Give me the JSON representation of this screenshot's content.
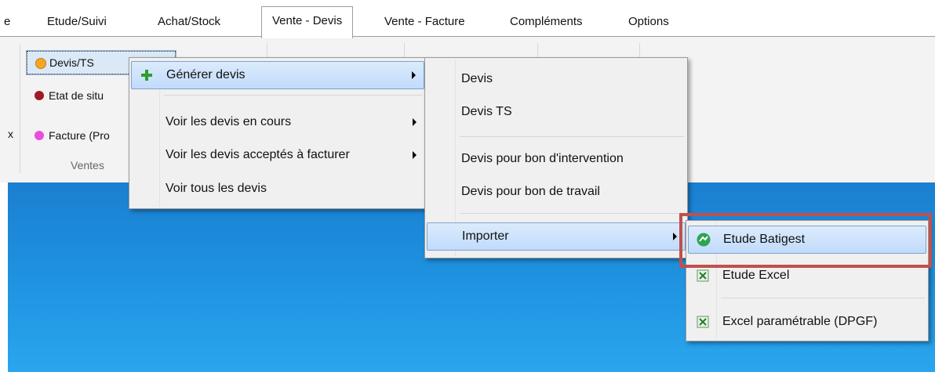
{
  "tabs": [
    {
      "label": "e"
    },
    {
      "label": "Etude/Suivi"
    },
    {
      "label": "Achat/Stock"
    },
    {
      "label": "Vente - Devis"
    },
    {
      "label": "Vente - Facture"
    },
    {
      "label": "Compléments"
    },
    {
      "label": "Options"
    }
  ],
  "ribbon": {
    "group_label": "Ventes",
    "edge_label": "x",
    "buttons": [
      {
        "label": "Devis/TS",
        "icon": "orange-dot-icon",
        "color": "#f5a623"
      },
      {
        "label": "Etat de situ",
        "icon": "red-dot-icon",
        "color": "#9e1c23"
      },
      {
        "label": "Facture (Pro",
        "icon": "pink-dot-icon",
        "color": "#e84ee0"
      }
    ]
  },
  "menu1": {
    "items": [
      {
        "label": "Générer devis",
        "icon": "plus-icon",
        "has_submenu": true
      },
      {
        "label": "Voir les devis en cours",
        "has_submenu": true
      },
      {
        "label": "Voir les devis acceptés à facturer",
        "has_submenu": true
      },
      {
        "label": "Voir tous les devis",
        "has_submenu": false
      }
    ]
  },
  "menu2": {
    "items": [
      {
        "label": "Devis"
      },
      {
        "label": "Devis TS"
      },
      {
        "label": "Devis pour bon d'intervention"
      },
      {
        "label": "Devis pour bon de travail"
      },
      {
        "label": "Importer",
        "has_submenu": true
      }
    ]
  },
  "menu3": {
    "items": [
      {
        "label": "Etude Batigest",
        "icon": "batigest-icon"
      },
      {
        "label": "Etude Excel",
        "icon": "excel-icon"
      },
      {
        "label": "Excel paramétrable (DPGF)",
        "icon": "excel-icon"
      }
    ]
  },
  "colors": {
    "highlight_border": "#c0504d",
    "desktop": "#1e90de"
  }
}
